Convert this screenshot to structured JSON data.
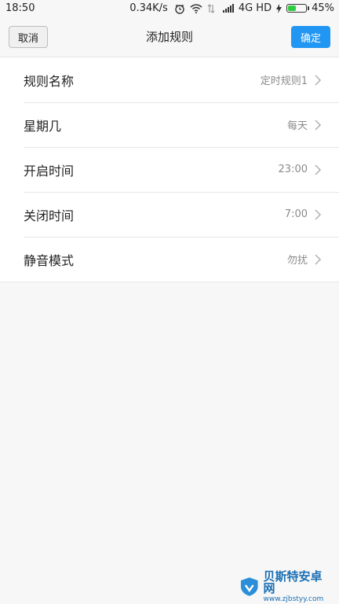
{
  "status_bar": {
    "time": "18:50",
    "net_speed": "0.34K/s",
    "network_type": "4G HD",
    "battery": "45%",
    "battery_level": 0.45,
    "icons": [
      "alarm-icon",
      "wifi-icon",
      "signal-icon",
      "bolt-icon",
      "battery-icon"
    ]
  },
  "header": {
    "cancel_label": "取消",
    "title": "添加规则",
    "confirm_label": "确定",
    "accent_color": "#2196f3"
  },
  "rows": [
    {
      "label": "规则名称",
      "value": "定时规则1"
    },
    {
      "label": "星期几",
      "value": "每天"
    },
    {
      "label": "开启时间",
      "value": "23:00"
    },
    {
      "label": "关闭时间",
      "value": "7:00"
    },
    {
      "label": "静音模式",
      "value": "勿扰"
    }
  ],
  "watermark": {
    "title": "贝斯特安卓网",
    "url": "www.zjbstyy.com"
  }
}
